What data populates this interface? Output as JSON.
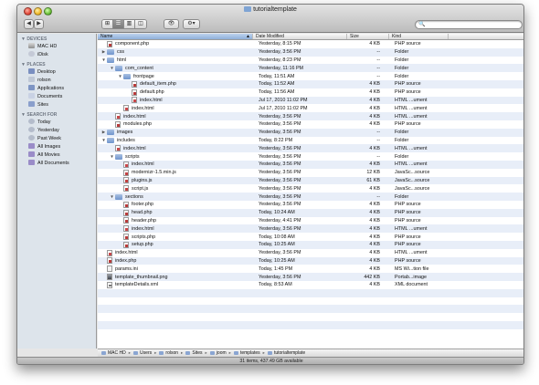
{
  "window": {
    "title": "tutorialtemplate",
    "status": "31 items, 437.49 GB available"
  },
  "toolbar": {
    "back_label": "◀",
    "forward_label": "▶",
    "view_modes": [
      "⊞",
      "☰",
      "▥",
      "◫"
    ],
    "quicklook_label": "👁",
    "action_label": "⚙▾",
    "search_label": "🔍",
    "search_placeholder": ""
  },
  "sidebar": {
    "sections": [
      {
        "heading": "DEVICES",
        "items": [
          {
            "label": "MAC HD",
            "icon": "disk-icon"
          },
          {
            "label": "iDisk",
            "icon": "cloud-icon"
          }
        ]
      },
      {
        "heading": "PLACES",
        "items": [
          {
            "label": "Desktop",
            "icon": "desktop-icon"
          },
          {
            "label": "rolson",
            "icon": "home-icon"
          },
          {
            "label": "Applications",
            "icon": "applications-icon"
          },
          {
            "label": "Documents",
            "icon": "documents-icon"
          },
          {
            "label": "Sites",
            "icon": "sites-icon"
          }
        ]
      },
      {
        "heading": "SEARCH FOR",
        "items": [
          {
            "label": "Today",
            "icon": "clock-icon"
          },
          {
            "label": "Yesterday",
            "icon": "clock-icon"
          },
          {
            "label": "Past Week",
            "icon": "clock-icon"
          },
          {
            "label": "All Images",
            "icon": "smart-folder-icon"
          },
          {
            "label": "All Movies",
            "icon": "smart-folder-icon"
          },
          {
            "label": "All Documents",
            "icon": "smart-folder-icon"
          }
        ]
      }
    ]
  },
  "columns": {
    "name": "Name",
    "date": "Date Modified",
    "size": "Size",
    "kind": "Kind"
  },
  "files": [
    {
      "name": "component.php",
      "level": 0,
      "type": "php",
      "disclosure": "",
      "date": "Yesterday, 8:15 PM",
      "size": "4 KB",
      "kind": "PHP source"
    },
    {
      "name": "css",
      "level": 0,
      "type": "folder",
      "disclosure": "▶",
      "date": "Yesterday, 3:56 PM",
      "size": "--",
      "kind": "Folder"
    },
    {
      "name": "html",
      "level": 0,
      "type": "folder",
      "disclosure": "▼",
      "date": "Yesterday, 8:23 PM",
      "size": "--",
      "kind": "Folder"
    },
    {
      "name": "com_content",
      "level": 1,
      "type": "folder",
      "disclosure": "▼",
      "date": "Yesterday, 11:16 PM",
      "size": "--",
      "kind": "Folder"
    },
    {
      "name": "frontpage",
      "level": 2,
      "type": "folder",
      "disclosure": "▼",
      "date": "Today, 11:51 AM",
      "size": "--",
      "kind": "Folder"
    },
    {
      "name": "default_item.php",
      "level": 3,
      "type": "php",
      "disclosure": "",
      "date": "Today, 11:52 AM",
      "size": "4 KB",
      "kind": "PHP source"
    },
    {
      "name": "default.php",
      "level": 3,
      "type": "php",
      "disclosure": "",
      "date": "Today, 11:56 AM",
      "size": "4 KB",
      "kind": "PHP source"
    },
    {
      "name": "index.html",
      "level": 3,
      "type": "html",
      "disclosure": "",
      "date": "Jul 17, 2010 11:02 PM",
      "size": "4 KB",
      "kind": "HTML ...ument"
    },
    {
      "name": "index.html",
      "level": 2,
      "type": "html",
      "disclosure": "",
      "date": "Jul 17, 2010 11:02 PM",
      "size": "4 KB",
      "kind": "HTML ...ument"
    },
    {
      "name": "index.html",
      "level": 1,
      "type": "html",
      "disclosure": "",
      "date": "Yesterday, 3:56 PM",
      "size": "4 KB",
      "kind": "HTML ...ument"
    },
    {
      "name": "modules.php",
      "level": 1,
      "type": "php",
      "disclosure": "",
      "date": "Yesterday, 3:56 PM",
      "size": "4 KB",
      "kind": "PHP source"
    },
    {
      "name": "images",
      "level": 0,
      "type": "folder",
      "disclosure": "▶",
      "date": "Yesterday, 3:56 PM",
      "size": "--",
      "kind": "Folder"
    },
    {
      "name": "includes",
      "level": 0,
      "type": "folder",
      "disclosure": "▼",
      "date": "Today, 8:22 PM",
      "size": "--",
      "kind": "Folder"
    },
    {
      "name": "index.html",
      "level": 1,
      "type": "html",
      "disclosure": "",
      "date": "Yesterday, 3:56 PM",
      "size": "4 KB",
      "kind": "HTML ...ument"
    },
    {
      "name": "scripts",
      "level": 1,
      "type": "folder",
      "disclosure": "▼",
      "date": "Yesterday, 3:56 PM",
      "size": "--",
      "kind": "Folder"
    },
    {
      "name": "index.html",
      "level": 2,
      "type": "html",
      "disclosure": "",
      "date": "Yesterday, 3:56 PM",
      "size": "4 KB",
      "kind": "HTML ...ument"
    },
    {
      "name": "modernizr-1.5.min.js",
      "level": 2,
      "type": "js",
      "disclosure": "",
      "date": "Yesterday, 3:56 PM",
      "size": "12 KB",
      "kind": "JavaSc...source"
    },
    {
      "name": "plugins.js",
      "level": 2,
      "type": "js",
      "disclosure": "",
      "date": "Yesterday, 3:56 PM",
      "size": "61 KB",
      "kind": "JavaSc...source"
    },
    {
      "name": "script.js",
      "level": 2,
      "type": "js",
      "disclosure": "",
      "date": "Yesterday, 3:56 PM",
      "size": "4 KB",
      "kind": "JavaSc...source"
    },
    {
      "name": "sections",
      "level": 1,
      "type": "folder",
      "disclosure": "▼",
      "date": "Yesterday, 3:56 PM",
      "size": "--",
      "kind": "Folder"
    },
    {
      "name": "footer.php",
      "level": 2,
      "type": "php",
      "disclosure": "",
      "date": "Yesterday, 3:56 PM",
      "size": "4 KB",
      "kind": "PHP source"
    },
    {
      "name": "head.php",
      "level": 2,
      "type": "php",
      "disclosure": "",
      "date": "Today, 10:24 AM",
      "size": "4 KB",
      "kind": "PHP source"
    },
    {
      "name": "header.php",
      "level": 2,
      "type": "php",
      "disclosure": "",
      "date": "Yesterday, 4:41 PM",
      "size": "4 KB",
      "kind": "PHP source"
    },
    {
      "name": "index.html",
      "level": 2,
      "type": "html",
      "disclosure": "",
      "date": "Yesterday, 3:56 PM",
      "size": "4 KB",
      "kind": "HTML ...ument"
    },
    {
      "name": "scripts.php",
      "level": 2,
      "type": "php",
      "disclosure": "",
      "date": "Today, 10:08 AM",
      "size": "4 KB",
      "kind": "PHP source"
    },
    {
      "name": "setup.php",
      "level": 2,
      "type": "php",
      "disclosure": "",
      "date": "Today, 10:25 AM",
      "size": "4 KB",
      "kind": "PHP source"
    },
    {
      "name": "index.html",
      "level": 0,
      "type": "html",
      "disclosure": "",
      "date": "Yesterday, 3:56 PM",
      "size": "4 KB",
      "kind": "HTML ...ument"
    },
    {
      "name": "index.php",
      "level": 0,
      "type": "php",
      "disclosure": "",
      "date": "Today, 10:25 AM",
      "size": "4 KB",
      "kind": "PHP source"
    },
    {
      "name": "params.ini",
      "level": 0,
      "type": "ini",
      "disclosure": "",
      "date": "Today, 1:45 PM",
      "size": "4 KB",
      "kind": "MS Wi...tion file"
    },
    {
      "name": "template_thumbnail.png",
      "level": 0,
      "type": "png",
      "disclosure": "",
      "date": "Yesterday, 3:56 PM",
      "size": "442 KB",
      "kind": "Portab...image"
    },
    {
      "name": "templateDetails.xml",
      "level": 0,
      "type": "xml",
      "disclosure": "",
      "date": "Today, 8:53 AM",
      "size": "4 KB",
      "kind": "XML document"
    }
  ],
  "filler_rows": 6,
  "pathbar": [
    "MAC HD",
    "Users",
    "rolson",
    "Sites",
    "joom",
    "templates",
    "tutorialtemplate"
  ],
  "pathbar_separator": "▸"
}
